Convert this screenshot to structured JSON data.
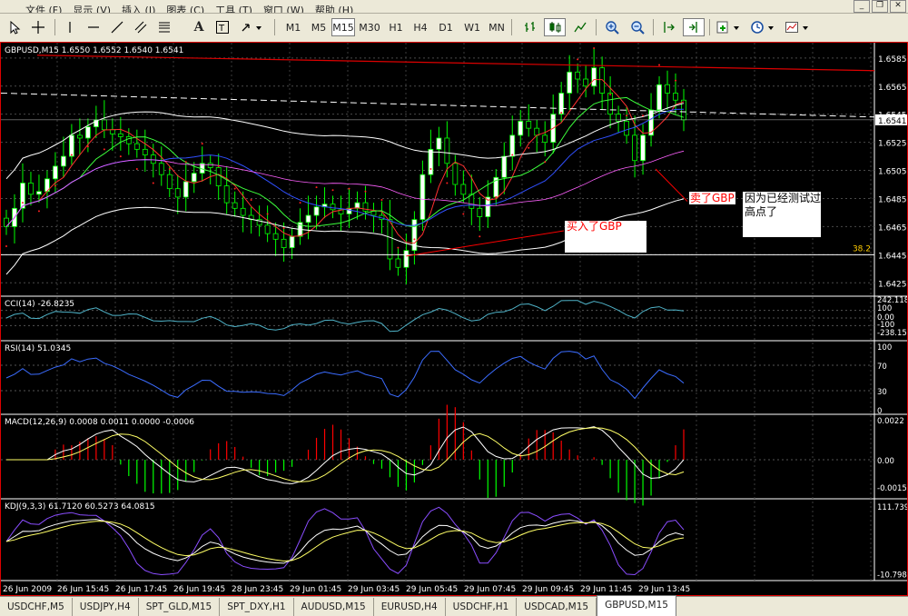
{
  "menu": {
    "items": [
      "文件 (F)",
      "显示 (V)",
      "插入 (I)",
      "图表 (C)",
      "工具 (T)",
      "窗口 (W)",
      "帮助 (H)"
    ]
  },
  "timeframes": [
    "M1",
    "M5",
    "M15",
    "M30",
    "H1",
    "H4",
    "D1",
    "W1",
    "MN"
  ],
  "active_timeframe": "M15",
  "toolbar_icons": [
    "cursor-icon",
    "crosshair-icon",
    "vertical-line-icon",
    "horizontal-line-icon",
    "trendline-icon",
    "channel-icon",
    "fibonacci-icon",
    "text-icon",
    "text-label-icon",
    "arrow-dropdown-icon"
  ],
  "chart": {
    "header": "GBPUSD,M15  1.6550 1.6552 1.6540 1.6541",
    "current_price": "1.6541",
    "price_axis": [
      "1.6585",
      "1.6565",
      "1.6545",
      "1.6525",
      "1.6505",
      "1.6485",
      "1.6465",
      "1.6445",
      "1.6425"
    ],
    "fib_label": "38.2",
    "annotations": {
      "buy": "买入了GBP",
      "sell_red": "卖了GBP",
      "sell_black": "因为已经测试过高点了"
    }
  },
  "indicators": {
    "cci": {
      "header": "CCI(14) -26.8235",
      "axis": [
        "242.118",
        "100",
        "0.00",
        "-100",
        "-238.154"
      ]
    },
    "rsi": {
      "header": "RSI(14) 51.0345",
      "axis": [
        "100",
        "70",
        "30",
        "0"
      ]
    },
    "macd": {
      "header": "MACD(12,26,9) 0.0008 0.0011 0.0000 -0.0006",
      "axis": [
        "0.0022",
        "0.00",
        "-0.0015"
      ]
    },
    "kdj": {
      "header": "KDJ(9,3,3) 61.7120 60.5273 64.0815",
      "axis": [
        "111.739",
        "-10.798"
      ]
    }
  },
  "time_axis": [
    "26 Jun 2009",
    "26 Jun 15:45",
    "26 Jun 17:45",
    "26 Jun 19:45",
    "28 Jun 23:45",
    "29 Jun 01:45",
    "29 Jun 03:45",
    "29 Jun 05:45",
    "29 Jun 07:45",
    "29 Jun 09:45",
    "29 Jun 11:45",
    "29 Jun 13:45"
  ],
  "tabs": [
    "USDCHF,M5",
    "USDJPY,H4",
    "SPT_GLD,M15",
    "SPT_DXY,H1",
    "AUDUSD,M15",
    "EURUSD,H4",
    "USDCHF,H1",
    "USDCAD,M15",
    "GBPUSD,M15"
  ],
  "active_tab": "GBPUSD,M15",
  "colors": {
    "bull": "#ffffff",
    "bear": "#000000",
    "candle_outline": "#00ff00",
    "macd_pos": "#ff0000",
    "macd_neg": "#00ff00",
    "annotation_red": "#ff0000",
    "frame": "#dd0000"
  },
  "chart_data": {
    "type": "candlestick",
    "symbol": "GBPUSD",
    "timeframe": "M15",
    "ylim": [
      1.642,
      1.6592
    ],
    "closes": [
      1.6465,
      1.6478,
      1.6496,
      1.6488,
      1.649,
      1.6499,
      1.6508,
      1.6515,
      1.653,
      1.6528,
      1.6536,
      1.6541,
      1.6534,
      1.6531,
      1.6529,
      1.6524,
      1.652,
      1.6516,
      1.651,
      1.6502,
      1.6492,
      1.6486,
      1.6497,
      1.6503,
      1.651,
      1.6507,
      1.6494,
      1.6482,
      1.6478,
      1.6473,
      1.647,
      1.6466,
      1.646,
      1.6456,
      1.645,
      1.6458,
      1.6468,
      1.6473,
      1.6479,
      1.6481,
      1.6477,
      1.6474,
      1.6478,
      1.6482,
      1.6476,
      1.6473,
      1.647,
      1.6442,
      1.6436,
      1.6448,
      1.647,
      1.6502,
      1.652,
      1.6528,
      1.651,
      1.6495,
      1.6488,
      1.6478,
      1.6472,
      1.6486,
      1.65,
      1.6515,
      1.653,
      1.654,
      1.6535,
      1.653,
      1.6525,
      1.6545,
      1.656,
      1.6575,
      1.657,
      1.6565,
      1.6578,
      1.656,
      1.6545,
      1.654,
      1.653,
      1.6512,
      1.653,
      1.6548,
      1.6566,
      1.656,
      1.6555,
      1.6541
    ]
  }
}
